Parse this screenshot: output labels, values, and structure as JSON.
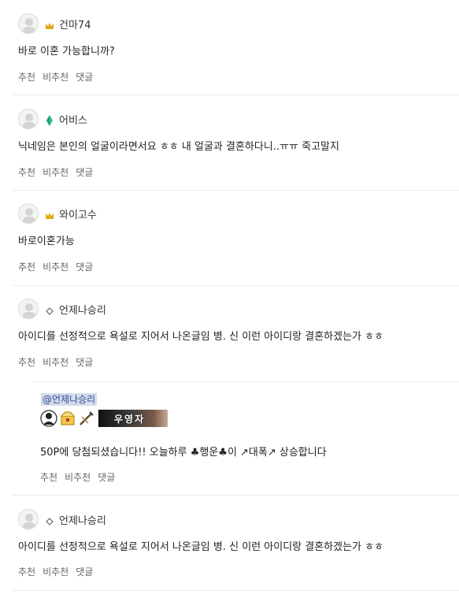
{
  "actions": {
    "recommend": "추천",
    "not_recommend": "비추천",
    "reply": "댓글"
  },
  "comments": [
    {
      "nickname": "건마74",
      "badge": "crown-icon",
      "text": "바로 이혼 가능합니까?"
    },
    {
      "nickname": "어비스",
      "badge": "gem-icon",
      "text": "닉네임은 본인의 얼굴이라면서요 ㅎㅎ 내 얼굴과 결혼하다니..ㅠㅠ 죽고말지"
    },
    {
      "nickname": "와이고수",
      "badge": "crown-icon",
      "text": "바로이혼가능"
    },
    {
      "nickname": "언제나승리",
      "badge": "diamond-outline-icon",
      "text": "아이디를 선정적으로 욕설로 지어서 나온글임 병. 신 이런 아이디랑 결혼하겠는가 ㅎㅎ"
    }
  ],
  "reply": {
    "mention": "@언제나승리",
    "banner_text": "우영자",
    "text": "50P에 당첨되셨습니다!! 오늘하루 ♣행운♣이 ↗대폭↗ 상승합니다"
  },
  "last_comment": {
    "nickname": "언제나승리",
    "badge": "diamond-outline-icon",
    "text": "아이디를 선정적으로 욕설로 지어서 나온글임 병. 신 이런 아이디랑 결혼하겠는가 ㅎㅎ"
  },
  "colors": {
    "mention_bg": "#d6dce8",
    "divider": "#ececec",
    "gem": "#2fbf9b",
    "crown": "#e3a916"
  }
}
